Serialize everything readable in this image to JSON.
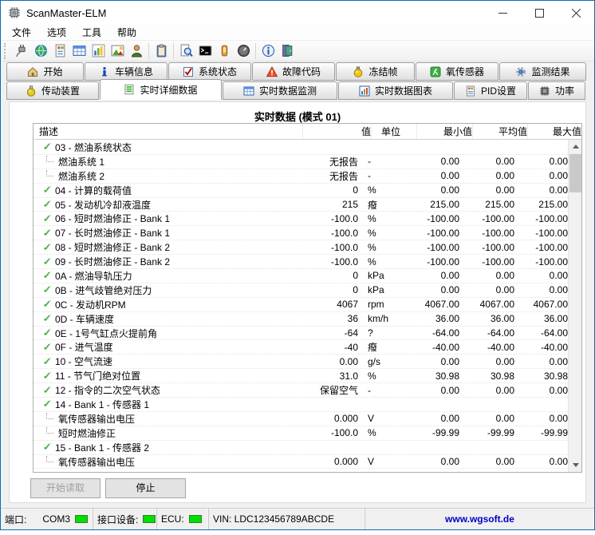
{
  "window": {
    "title": "ScanMaster-ELM"
  },
  "menu": {
    "items": [
      "文件",
      "选项",
      "工具",
      "帮助"
    ]
  },
  "toolbar": {
    "icons": [
      "connect-icon",
      "globe-icon",
      "report-icon",
      "grid-icon",
      "chart-icon",
      "image-icon",
      "user-icon",
      "clipboard-icon",
      "search-icon",
      "terminal-icon",
      "battery-icon",
      "gauge-icon",
      "info-icon",
      "exit-icon"
    ]
  },
  "tabs": {
    "selected": "实时详细数据",
    "row1": [
      {
        "label": "开始",
        "icon": "home-icon"
      },
      {
        "label": "车辆信息",
        "icon": "vehicle-info-icon"
      },
      {
        "label": "系统状态",
        "icon": "system-status-icon"
      },
      {
        "label": "故障代码",
        "icon": "fault-codes-icon"
      },
      {
        "label": "冻结帧",
        "icon": "freeze-frame-icon"
      },
      {
        "label": "氧传感器",
        "icon": "oxygen-sensor-icon"
      },
      {
        "label": "监测结果",
        "icon": "monitor-results-icon"
      }
    ],
    "row2": [
      {
        "label": "传动装置",
        "icon": "transmission-icon"
      },
      {
        "label": "实时详细数据",
        "icon": "live-data-icon"
      },
      {
        "label": "实时数据监测",
        "icon": "live-monitor-icon"
      },
      {
        "label": "实时数据图表",
        "icon": "live-chart-icon"
      },
      {
        "label": "PID设置",
        "icon": "pid-settings-icon"
      },
      {
        "label": "功率",
        "icon": "power-icon"
      }
    ]
  },
  "table": {
    "title": "实时数据 (模式 01)",
    "headers": [
      "描述",
      "值",
      "单位",
      "最小值",
      "平均值",
      "最大值"
    ],
    "rows": [
      {
        "type": "group",
        "desc": "03 - 燃油系统状态",
        "value": "",
        "unit": "",
        "min": "",
        "avg": "",
        "max": ""
      },
      {
        "type": "sub",
        "desc": "燃油系统 1",
        "value": "无报告",
        "unit": "-",
        "min": "0.00",
        "avg": "0.00",
        "max": "0.00"
      },
      {
        "type": "sub",
        "desc": "燃油系统 2",
        "value": "无报告",
        "unit": "-",
        "min": "0.00",
        "avg": "0.00",
        "max": "0.00"
      },
      {
        "type": "param",
        "desc": "04 - 计算的载荷值",
        "value": "0",
        "unit": "%",
        "min": "0.00",
        "avg": "0.00",
        "max": "0.00"
      },
      {
        "type": "param",
        "desc": "05 - 发动机冷却液温度",
        "value": "215",
        "unit": "癈",
        "min": "215.00",
        "avg": "215.00",
        "max": "215.00"
      },
      {
        "type": "param",
        "desc": "06 - 短时燃油修正 - Bank 1",
        "value": "-100.0",
        "unit": "%",
        "min": "-100.00",
        "avg": "-100.00",
        "max": "-100.00"
      },
      {
        "type": "param",
        "desc": "07 - 长时燃油修正 - Bank 1",
        "value": "-100.0",
        "unit": "%",
        "min": "-100.00",
        "avg": "-100.00",
        "max": "-100.00"
      },
      {
        "type": "param",
        "desc": "08 - 短时燃油修正 - Bank 2",
        "value": "-100.0",
        "unit": "%",
        "min": "-100.00",
        "avg": "-100.00",
        "max": "-100.00"
      },
      {
        "type": "param",
        "desc": "09 - 长时燃油修正 - Bank 2",
        "value": "-100.0",
        "unit": "%",
        "min": "-100.00",
        "avg": "-100.00",
        "max": "-100.00"
      },
      {
        "type": "param",
        "desc": "0A - 燃油导轨压力",
        "value": "0",
        "unit": "kPa",
        "min": "0.00",
        "avg": "0.00",
        "max": "0.00"
      },
      {
        "type": "param",
        "desc": "0B - 进气歧管绝对压力",
        "value": "0",
        "unit": "kPa",
        "min": "0.00",
        "avg": "0.00",
        "max": "0.00"
      },
      {
        "type": "param",
        "desc": "0C - 发动机RPM",
        "value": "4067",
        "unit": "rpm",
        "min": "4067.00",
        "avg": "4067.00",
        "max": "4067.00"
      },
      {
        "type": "param",
        "desc": "0D - 车辆速度",
        "value": "36",
        "unit": "km/h",
        "min": "36.00",
        "avg": "36.00",
        "max": "36.00"
      },
      {
        "type": "param",
        "desc": "0E - 1号气缸点火提前角",
        "value": "-64",
        "unit": "?",
        "min": "-64.00",
        "avg": "-64.00",
        "max": "-64.00"
      },
      {
        "type": "param",
        "desc": "0F - 进气温度",
        "value": "-40",
        "unit": "癈",
        "min": "-40.00",
        "avg": "-40.00",
        "max": "-40.00"
      },
      {
        "type": "param",
        "desc": "10 - 空气流速",
        "value": "0.00",
        "unit": "g/s",
        "min": "0.00",
        "avg": "0.00",
        "max": "0.00"
      },
      {
        "type": "param",
        "desc": "11 - 节气门绝对位置",
        "value": "31.0",
        "unit": "%",
        "min": "30.98",
        "avg": "30.98",
        "max": "30.98"
      },
      {
        "type": "param",
        "desc": "12 - 指令的二次空气状态",
        "value": "保留空气",
        "unit": "-",
        "min": "0.00",
        "avg": "0.00",
        "max": "0.00"
      },
      {
        "type": "group",
        "desc": "14 - Bank 1 - 传感器 1",
        "value": "",
        "unit": "",
        "min": "",
        "avg": "",
        "max": ""
      },
      {
        "type": "sub",
        "desc": "氧传感器输出电压",
        "value": "0.000",
        "unit": "V",
        "min": "0.00",
        "avg": "0.00",
        "max": "0.00"
      },
      {
        "type": "sub",
        "desc": "短时燃油修正",
        "value": "-100.0",
        "unit": "%",
        "min": "-99.99",
        "avg": "-99.99",
        "max": "-99.99"
      },
      {
        "type": "group",
        "desc": "15 - Bank 1 - 传感器 2",
        "value": "",
        "unit": "",
        "min": "",
        "avg": "",
        "max": ""
      },
      {
        "type": "sub",
        "desc": "氧传感器输出电压",
        "value": "0.000",
        "unit": "V",
        "min": "0.00",
        "avg": "0.00",
        "max": "0.00"
      }
    ]
  },
  "buttons": {
    "start": "开始读取",
    "stop": "停止",
    "start_enabled": false
  },
  "statusbar": {
    "port_label": "端口:",
    "port_value": "COM3",
    "interface_label": "接口设备:",
    "ecu_label": "ECU:",
    "vin": "VIN: LDC123456789ABCDE",
    "website": "www.wgsoft.de"
  },
  "colors": {
    "accent_border": "#1069b0",
    "led_green": "#00e000",
    "link_blue": "#0000c8",
    "check_green": "#1fa51f"
  }
}
